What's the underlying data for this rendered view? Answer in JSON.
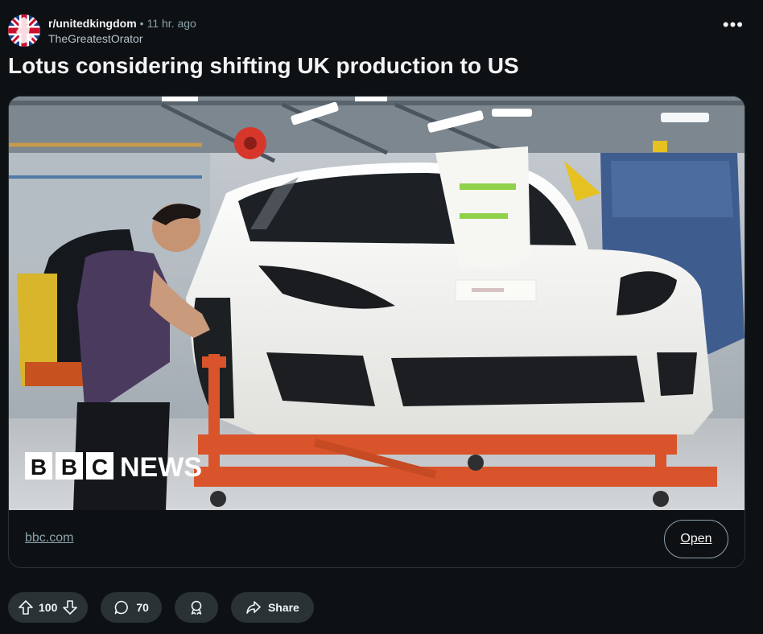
{
  "post": {
    "subreddit": "r/unitedkingdom",
    "separator": "•",
    "time": "11 hr. ago",
    "author": "TheGreatestOrator",
    "title": "Lotus considering shifting UK production to US",
    "more_label": "•••"
  },
  "link": {
    "domain": "bbc.com",
    "open_label": "Open",
    "thumbnail_brand": "BBC",
    "thumbnail_brand_letters": [
      "B",
      "B",
      "C"
    ],
    "thumbnail_news": "NEWS"
  },
  "actions": {
    "votes": "100",
    "comments": "70",
    "share_label": "Share"
  },
  "icons": {
    "upvote": "arrow-up-icon",
    "downvote": "arrow-down-icon",
    "comment": "speech-bubble-icon",
    "award": "award-icon",
    "share": "share-arrow-icon",
    "more": "ellipsis-icon"
  },
  "colors": {
    "background": "#0e1113",
    "pill": "#2a3236",
    "muted_text": "#8ba2ad",
    "car": "#f1f1ee",
    "stand": "#d9542b"
  }
}
